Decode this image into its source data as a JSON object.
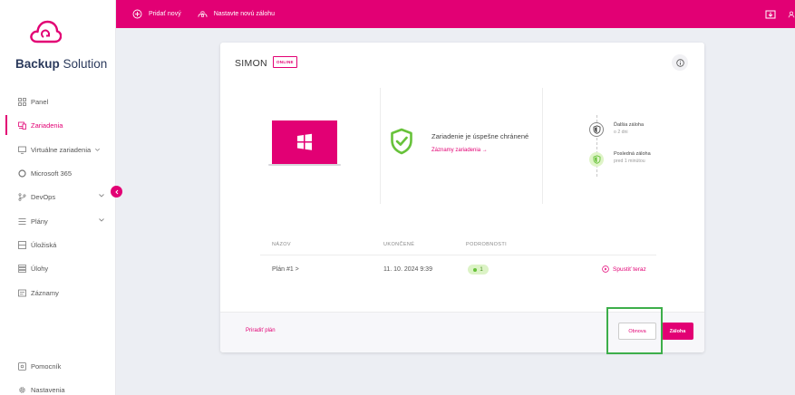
{
  "app": {
    "brand_bold": "Backup",
    "brand_thin": " Solution"
  },
  "topbar": {
    "add_new": "Pridať nový",
    "setup_backup": "Nastavte novú zálohu"
  },
  "sidebar": {
    "items": [
      {
        "label": "Panel",
        "icon": "grid-icon"
      },
      {
        "label": "Zariadenia",
        "icon": "devices-icon",
        "active": true
      },
      {
        "label": "Virtuálne zariadenia",
        "icon": "monitor-icon"
      },
      {
        "label": "Microsoft 365",
        "icon": "microsoft-icon"
      },
      {
        "label": "DevOps",
        "icon": "branch-icon"
      },
      {
        "label": "Plány",
        "icon": "list-icon"
      },
      {
        "label": "Úložiská",
        "icon": "storage-icon"
      },
      {
        "label": "Úlohy",
        "icon": "tasks-icon"
      },
      {
        "label": "Záznamy",
        "icon": "records-icon"
      },
      {
        "label": "Pomocník",
        "icon": "help-icon"
      },
      {
        "label": "Nastavenia",
        "icon": "gear-icon"
      }
    ]
  },
  "device": {
    "name": "SIMON",
    "status": "ONLINE",
    "protection_text": "Zariadenie je úspešne chránené",
    "records_link": "Záznamy zariadenia →",
    "next_backup_title": "Ďalšia záloha",
    "next_backup_sub": "o 2 dni",
    "last_backup_title": "Posledná záloha",
    "last_backup_sub": "pred 1 minútou"
  },
  "plans_table": {
    "headers": [
      "NÁZOV",
      "UKONČENÉ",
      "PODROBNOSTI"
    ],
    "rows": [
      {
        "name": "Plán #1 >",
        "finished": "11. 10. 2024 9:39",
        "count": "1",
        "action": "Spustiť teraz"
      }
    ]
  },
  "footer": {
    "assign_plan": "Priradiť plán",
    "restore": "Obnova",
    "backup": "Záloha"
  },
  "colors": {
    "accent": "#e20074",
    "success": "#67c23a",
    "highlight": "#3dae4a"
  }
}
